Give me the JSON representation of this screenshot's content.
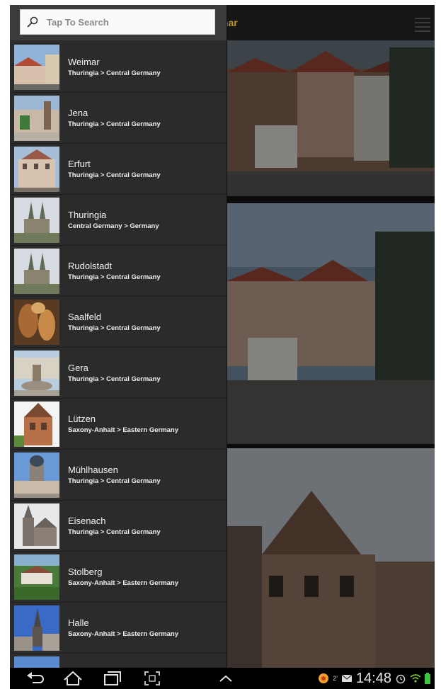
{
  "search": {
    "placeholder": "Tap To Search"
  },
  "background": {
    "title": "mar"
  },
  "drawer": {
    "items": [
      {
        "name": "Weimar",
        "sub": "Thuringia > Central Germany"
      },
      {
        "name": "Jena",
        "sub": "Thuringia > Central Germany"
      },
      {
        "name": "Erfurt",
        "sub": "Thuringia > Central Germany"
      },
      {
        "name": "Thuringia",
        "sub": "Central Germany > Germany"
      },
      {
        "name": "Rudolstadt",
        "sub": "Thuringia > Central Germany"
      },
      {
        "name": "Saalfeld",
        "sub": "Thuringia > Central Germany"
      },
      {
        "name": "Gera",
        "sub": "Thuringia > Central Germany"
      },
      {
        "name": "Lützen",
        "sub": "Saxony-Anhalt > Eastern Germany"
      },
      {
        "name": "Mühlhausen",
        "sub": "Thuringia > Central Germany"
      },
      {
        "name": "Eisenach",
        "sub": "Thuringia > Central Germany"
      },
      {
        "name": "Stolberg",
        "sub": "Saxony-Anhalt > Eastern Germany"
      },
      {
        "name": "Halle",
        "sub": "Saxony-Anhalt > Eastern Germany"
      }
    ]
  },
  "statusbar": {
    "time": "14:48",
    "notification_count": "2'"
  },
  "colors": {
    "accent": "#b99722",
    "drawer_bg": "#2b2b2b"
  }
}
